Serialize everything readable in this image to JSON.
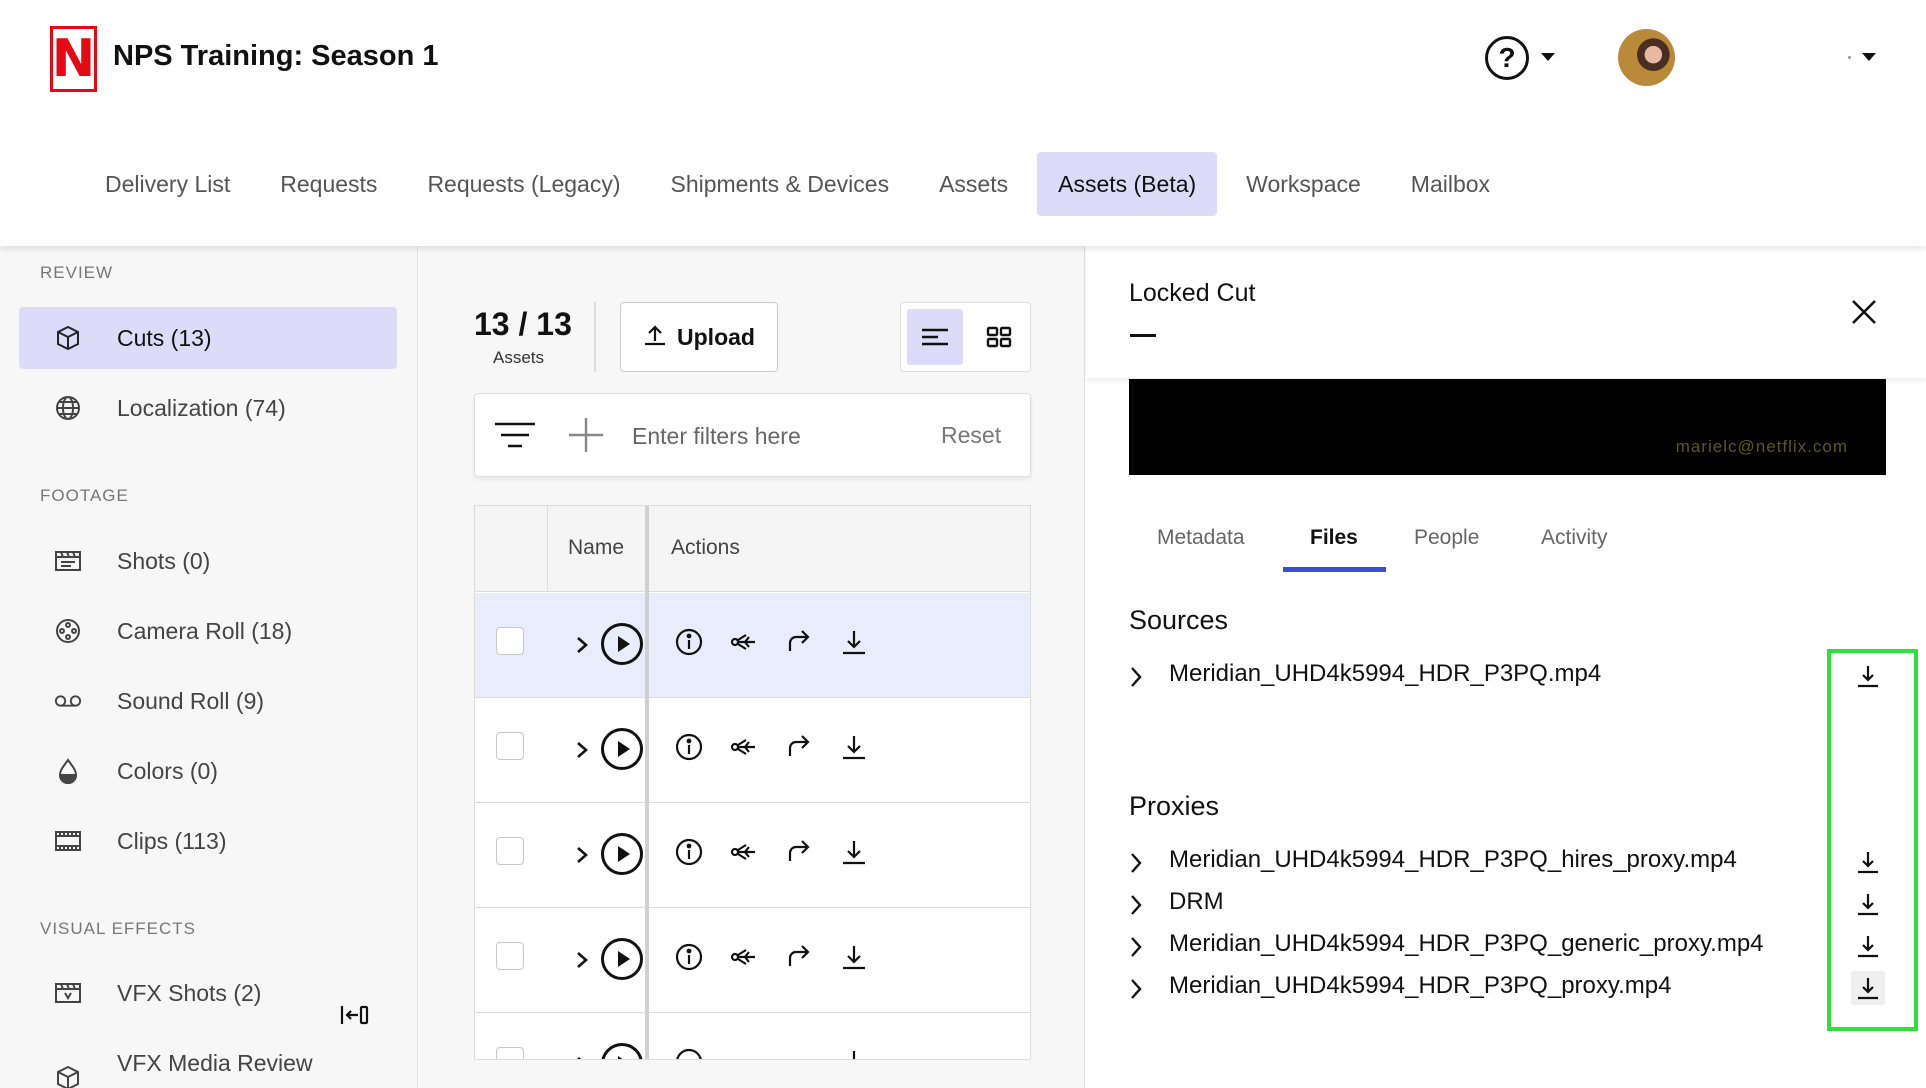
{
  "app": {
    "title": "NPS Training: Season 1",
    "logo_letter": "N",
    "brand_color": "#e50914",
    "help_icon": "question-circle-icon"
  },
  "nav": {
    "items": [
      {
        "label": "Delivery List",
        "active": false
      },
      {
        "label": "Requests",
        "active": false
      },
      {
        "label": "Requests (Legacy)",
        "active": false
      },
      {
        "label": "Shipments & Devices",
        "active": false
      },
      {
        "label": "Assets",
        "active": false
      },
      {
        "label": "Assets (Beta)",
        "active": true
      },
      {
        "label": "Workspace",
        "active": false
      },
      {
        "label": "Mailbox",
        "active": false
      }
    ]
  },
  "sidebar": {
    "sections": [
      {
        "label": "REVIEW",
        "items": [
          {
            "label": "Cuts (13)",
            "icon": "cube-icon",
            "active": true
          },
          {
            "label": "Localization (74)",
            "icon": "globe-icon",
            "active": false
          }
        ]
      },
      {
        "label": "FOOTAGE",
        "items": [
          {
            "label": "Shots (0)",
            "icon": "clapperboard-icon",
            "active": false
          },
          {
            "label": "Camera Roll (18)",
            "icon": "film-reel-icon",
            "active": false
          },
          {
            "label": "Sound Roll (9)",
            "icon": "voicemail-icon",
            "active": false
          },
          {
            "label": "Colors (0)",
            "icon": "droplet-icon",
            "active": false
          },
          {
            "label": "Clips (113)",
            "icon": "film-strip-icon",
            "active": false
          }
        ]
      },
      {
        "label": "VISUAL EFFECTS",
        "items": [
          {
            "label": "VFX Shots (2)",
            "icon": "vfx-clapperboard-icon",
            "active": false
          },
          {
            "label": "VFX Media Review",
            "icon": "cube-icon",
            "active": false
          }
        ]
      }
    ]
  },
  "assets": {
    "count": "13 / 13",
    "count_label": "Assets",
    "upload_label": "Upload",
    "filter_placeholder": "Enter filters here",
    "reset_label": "Reset",
    "columns": {
      "name": "Name",
      "actions": "Actions"
    },
    "rows": [
      {
        "selected": true
      },
      {
        "selected": false
      },
      {
        "selected": false
      },
      {
        "selected": false
      },
      {
        "selected": false
      }
    ]
  },
  "detail": {
    "title": "Locked Cut",
    "subtitle": "—",
    "watermark": "marielc@netflix.com",
    "tabs": [
      {
        "label": "Metadata",
        "active": false
      },
      {
        "label": "Files",
        "active": true
      },
      {
        "label": "People",
        "active": false
      },
      {
        "label": "Activity",
        "active": false
      }
    ],
    "sources_title": "Sources",
    "sources": [
      {
        "name": "Meridian_UHD4k5994_HDR_P3PQ.mp4"
      }
    ],
    "proxies_title": "Proxies",
    "proxies": [
      {
        "name": "Meridian_UHD4k5994_HDR_P3PQ_hires_proxy.mp4"
      },
      {
        "name": "DRM"
      },
      {
        "name": "Meridian_UHD4k5994_HDR_P3PQ_generic_proxy.mp4"
      },
      {
        "name": "Meridian_UHD4k5994_HDR_P3PQ_proxy.mp4"
      }
    ],
    "accent_color": "#3b4fd6",
    "highlight_color": "#2ee03a"
  }
}
